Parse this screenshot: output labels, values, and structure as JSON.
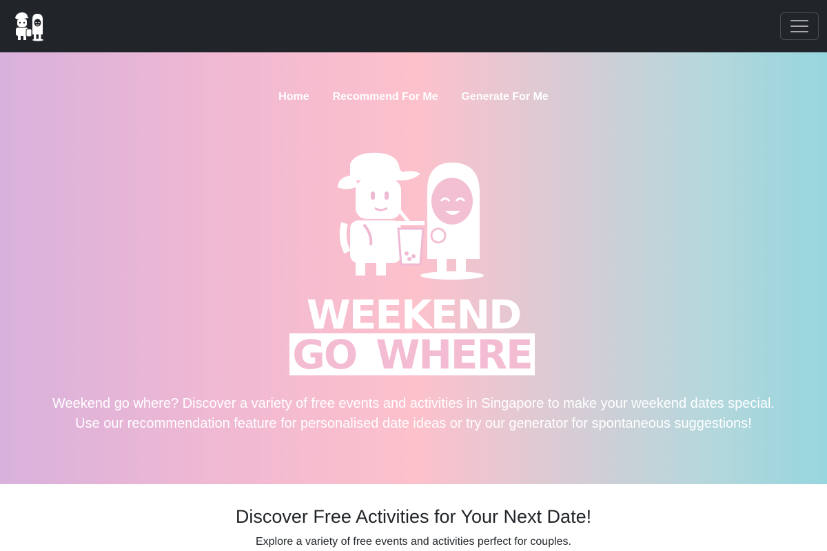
{
  "nav": {
    "links": [
      "Home",
      "Recommend For Me",
      "Generate For Me"
    ],
    "logo_icon": "couple-logo-icon",
    "menu_icon": "hamburger-menu-icon"
  },
  "hero": {
    "wordmark_line1": "WEEKEND",
    "wordmark_line2": "GO WHERE",
    "description": "Weekend go where? Discover a variety of free events and activities in Singapore to make your weekend dates special. Use our recommendation feature for personalised date ideas or try our generator for spontaneous suggestions!",
    "illustration_icon": "couple-illustration"
  },
  "section": {
    "title": "Discover Free Activities for Your Next Date!",
    "subtitle": "Explore a variety of free events and activities perfect for couples."
  },
  "colors": {
    "navbar_bg": "#212529",
    "gradient": [
      "#d8b1dc",
      "#fdc1cc",
      "#97d6de"
    ],
    "wordmark_pink": "#f4bcd2",
    "text_dark": "#212529"
  }
}
